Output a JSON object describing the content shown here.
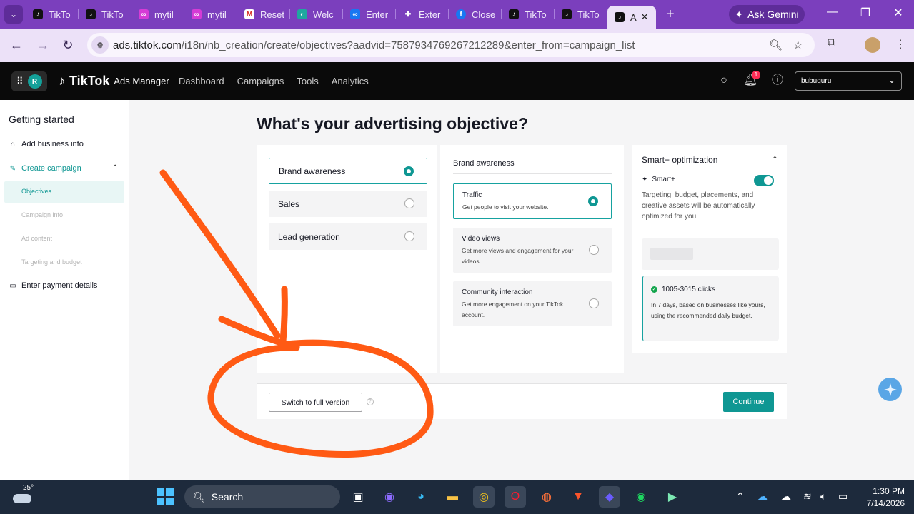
{
  "browser": {
    "tabs": [
      {
        "label": "TikTo",
        "icon": "tiktok-icon"
      },
      {
        "label": "TikTo",
        "icon": "tiktok-icon"
      },
      {
        "label": "mytil",
        "icon": "link-icon"
      },
      {
        "label": "mytil",
        "icon": "link-icon"
      },
      {
        "label": "Reset",
        "icon": "gmail-icon"
      },
      {
        "label": "Welc",
        "icon": "app-icon"
      },
      {
        "label": "Enter",
        "icon": "meta-icon"
      },
      {
        "label": "Exter",
        "icon": "puzzle-icon"
      },
      {
        "label": "Close",
        "icon": "facebook-icon"
      },
      {
        "label": "TikTo",
        "icon": "tiktok-icon"
      },
      {
        "label": "TikTo",
        "icon": "tiktok-icon"
      }
    ],
    "active_tab_label": "A",
    "gemini_label": "Ask Gemini",
    "url_host": "ads.tiktok.com",
    "url_path": "/i18n/nb_creation/create/objectives?aadvid=7587934769267212289&enter_from=campaign_list"
  },
  "header": {
    "avatar_letter": "R",
    "brand": "TikTok",
    "brand_sub": "Ads Manager",
    "nav": [
      "Dashboard",
      "Campaigns",
      "Tools",
      "Analytics"
    ],
    "notification_count": "1",
    "account": "bubuguru"
  },
  "sidebar": {
    "title": "Getting started",
    "add_business": "Add business info",
    "create_campaign": "Create campaign",
    "steps": [
      "Objectives",
      "Campaign info",
      "Ad content",
      "Targeting and budget"
    ],
    "payment": "Enter payment details"
  },
  "main": {
    "title": "What's your advertising objective?",
    "objectives": [
      "Brand awareness",
      "Sales",
      "Lead generation"
    ],
    "selected_objective": "Brand awareness",
    "goals_heading": "Brand awareness",
    "goals": [
      {
        "title": "Traffic",
        "desc": "Get people to visit your website."
      },
      {
        "title": "Video views",
        "desc": "Get more views and engagement for your videos."
      },
      {
        "title": "Community interaction",
        "desc": "Get more engagement on your TikTok account."
      }
    ],
    "smart": {
      "title": "Smart+ optimization",
      "toggle_label": "Smart+",
      "toggle_on": true,
      "desc": "Targeting, budget, placements, and creative assets will be automatically optimized for you.",
      "estimate_title": "1005-3015 clicks",
      "estimate_desc": "In 7 days, based on businesses like yours, using the recommended daily budget."
    },
    "switch_label": "Switch to full version",
    "continue_label": "Continue"
  },
  "taskbar": {
    "temperature": "25°",
    "search_label": "Search",
    "time": "1:30 PM",
    "date": "7/14/2026"
  },
  "colors": {
    "accent": "#0f9793",
    "browser_frame": "#7b3fbd",
    "annotation": "#ff5a14"
  }
}
